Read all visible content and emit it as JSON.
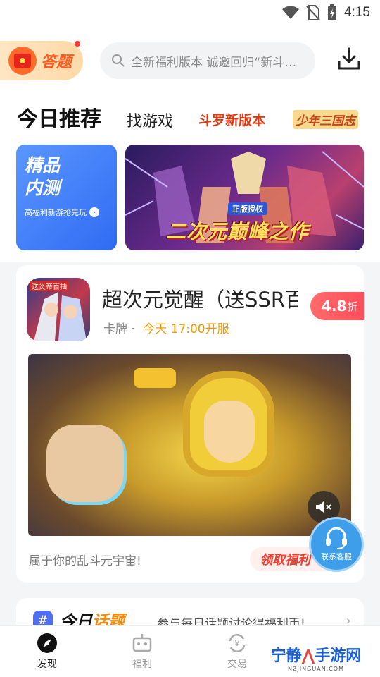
{
  "status_bar": {
    "time": "4:15"
  },
  "header": {
    "quiz_label": "答题",
    "search_placeholder": "全新福利版本 诚邀回归“新斗罗大陆”"
  },
  "tabs": {
    "main": "今日推荐",
    "find_games": "找游戏",
    "douluo": "斗罗新版本",
    "sanguo": "少年三国志"
  },
  "banners": {
    "left_title_line1": "精品",
    "left_title_line2": "内测",
    "left_subtitle": "高福利新游抢先玩",
    "right_badge": "正版授权",
    "right_caption": "二次元巅峰之作"
  },
  "game_card": {
    "icon_tag": "送炎帝百抽",
    "title": "超次元觉醒（送SSR百抽）",
    "category": "卡牌",
    "separator": "·",
    "open_time": "今天 17:00开服",
    "discount_value": "4.8",
    "discount_unit": "折",
    "description": "属于你的乱斗元宇宙!",
    "claim_label": "领取福利"
  },
  "customer_service": {
    "label": "联系客服"
  },
  "topic": {
    "hash": "#",
    "title_a": "今日",
    "title_b": "话题",
    "subtitle": "参与每日话题讨论得福利币!"
  },
  "bottom_nav": {
    "items": [
      {
        "label": "发现",
        "icon": "compass-icon"
      },
      {
        "label": "福利",
        "icon": "gift-robot-icon"
      },
      {
        "label": "交易",
        "icon": "exchange-icon"
      }
    ]
  },
  "watermark": {
    "part1": "宁静",
    "part2": "手游网",
    "sub": "NZJINGUAN.COM"
  },
  "colors": {
    "accent_orange": "#ff5a1f",
    "discount_red": "#ff4e5b",
    "brand_blue": "#2f6bf2"
  }
}
